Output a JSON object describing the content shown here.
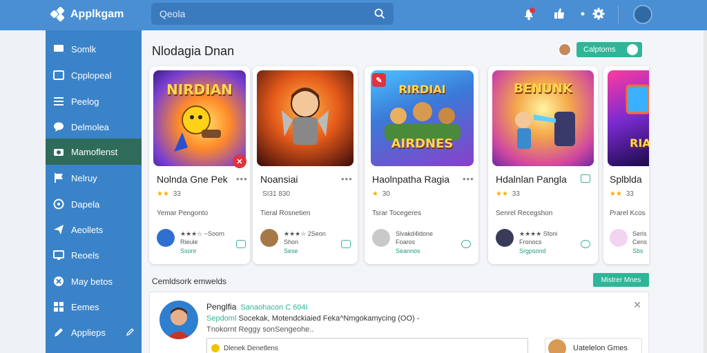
{
  "app": {
    "title": "Applkgam"
  },
  "search": {
    "placeholder": "Qeola"
  },
  "sidebar": {
    "items": [
      {
        "label": "Somlk",
        "icon": "screen-icon"
      },
      {
        "label": "Cpplopeal",
        "icon": "window-icon"
      },
      {
        "label": "Peelog",
        "icon": "list-icon"
      },
      {
        "label": "Delmolea",
        "icon": "chat-bubble-icon"
      },
      {
        "label": "Mamoflenst",
        "icon": "camera-icon"
      },
      {
        "label": "Nelruy",
        "icon": "flag-icon"
      },
      {
        "label": "Dapela",
        "icon": "gamepad-icon"
      },
      {
        "label": "Aeollets",
        "icon": "send-icon"
      },
      {
        "label": "Reoels",
        "icon": "monitor-icon"
      },
      {
        "label": "May betos",
        "icon": "close-circle-icon"
      },
      {
        "label": "Eemes",
        "icon": "grid-icon"
      },
      {
        "label": "Applieps",
        "icon": "pencil-icon"
      }
    ]
  },
  "main": {
    "title": "Nlodagia Dnan",
    "header_button": "Calptoms",
    "section_title": "Cemldsork emwelds",
    "section_button": "Mistrer Mnes"
  },
  "cards": [
    {
      "art_title": "NIRDIAN",
      "name": "Nolnda Gne Pek",
      "rating": "33",
      "category": "Yemar Pengonto",
      "meta1": "★★★☆ ~Soorn",
      "meta2": "Rieule",
      "meta3": "Ssonr"
    },
    {
      "art_title": "",
      "name": "Noansiai",
      "rating": "SI31 830",
      "category": "Tieral Rosnetien",
      "meta1": "★★★☆ 2Seon",
      "meta2": "Shon",
      "meta3": "Sese"
    },
    {
      "art_title": "AIRDNES",
      "name": "Haolnpatha Ragia",
      "rating": "30",
      "category": "Tsrar Tocegeres",
      "meta1": "Slvakd4ldone",
      "meta2": "Foaros",
      "meta3": "Seannos"
    },
    {
      "art_title": "BENUNK",
      "name": "Hdalnlan Pangla",
      "rating": "33",
      "category": "Senrel Recegshon",
      "meta1": "★★★★ Sfoni",
      "meta2": "Fronocs",
      "meta3": "Srgpsond"
    },
    {
      "art_title": "",
      "name": "Splblda",
      "rating": "33",
      "category": "Prarel Kcos",
      "meta1": "Seris",
      "meta2": "Cens",
      "meta3": "Sbs"
    }
  ],
  "feed": {
    "name": "Penglfia",
    "tag": "Sanaohacon C 604I",
    "line2_accent": "Sepdoml",
    "line2": "Socekak, Motendckiaied Feka^Nmgokamycing  (OO)  -",
    "line3": "Tnokornt Reggy sonSengeohe..",
    "box_text": "Dlenek Denetlens",
    "side_text": "Uatelelon Gmes"
  },
  "colors": {
    "topbar": "#4a8fd4",
    "sidebar": "#3a83c8",
    "sidebar_active": "#2f6b5a",
    "accent": "#2fb597"
  }
}
